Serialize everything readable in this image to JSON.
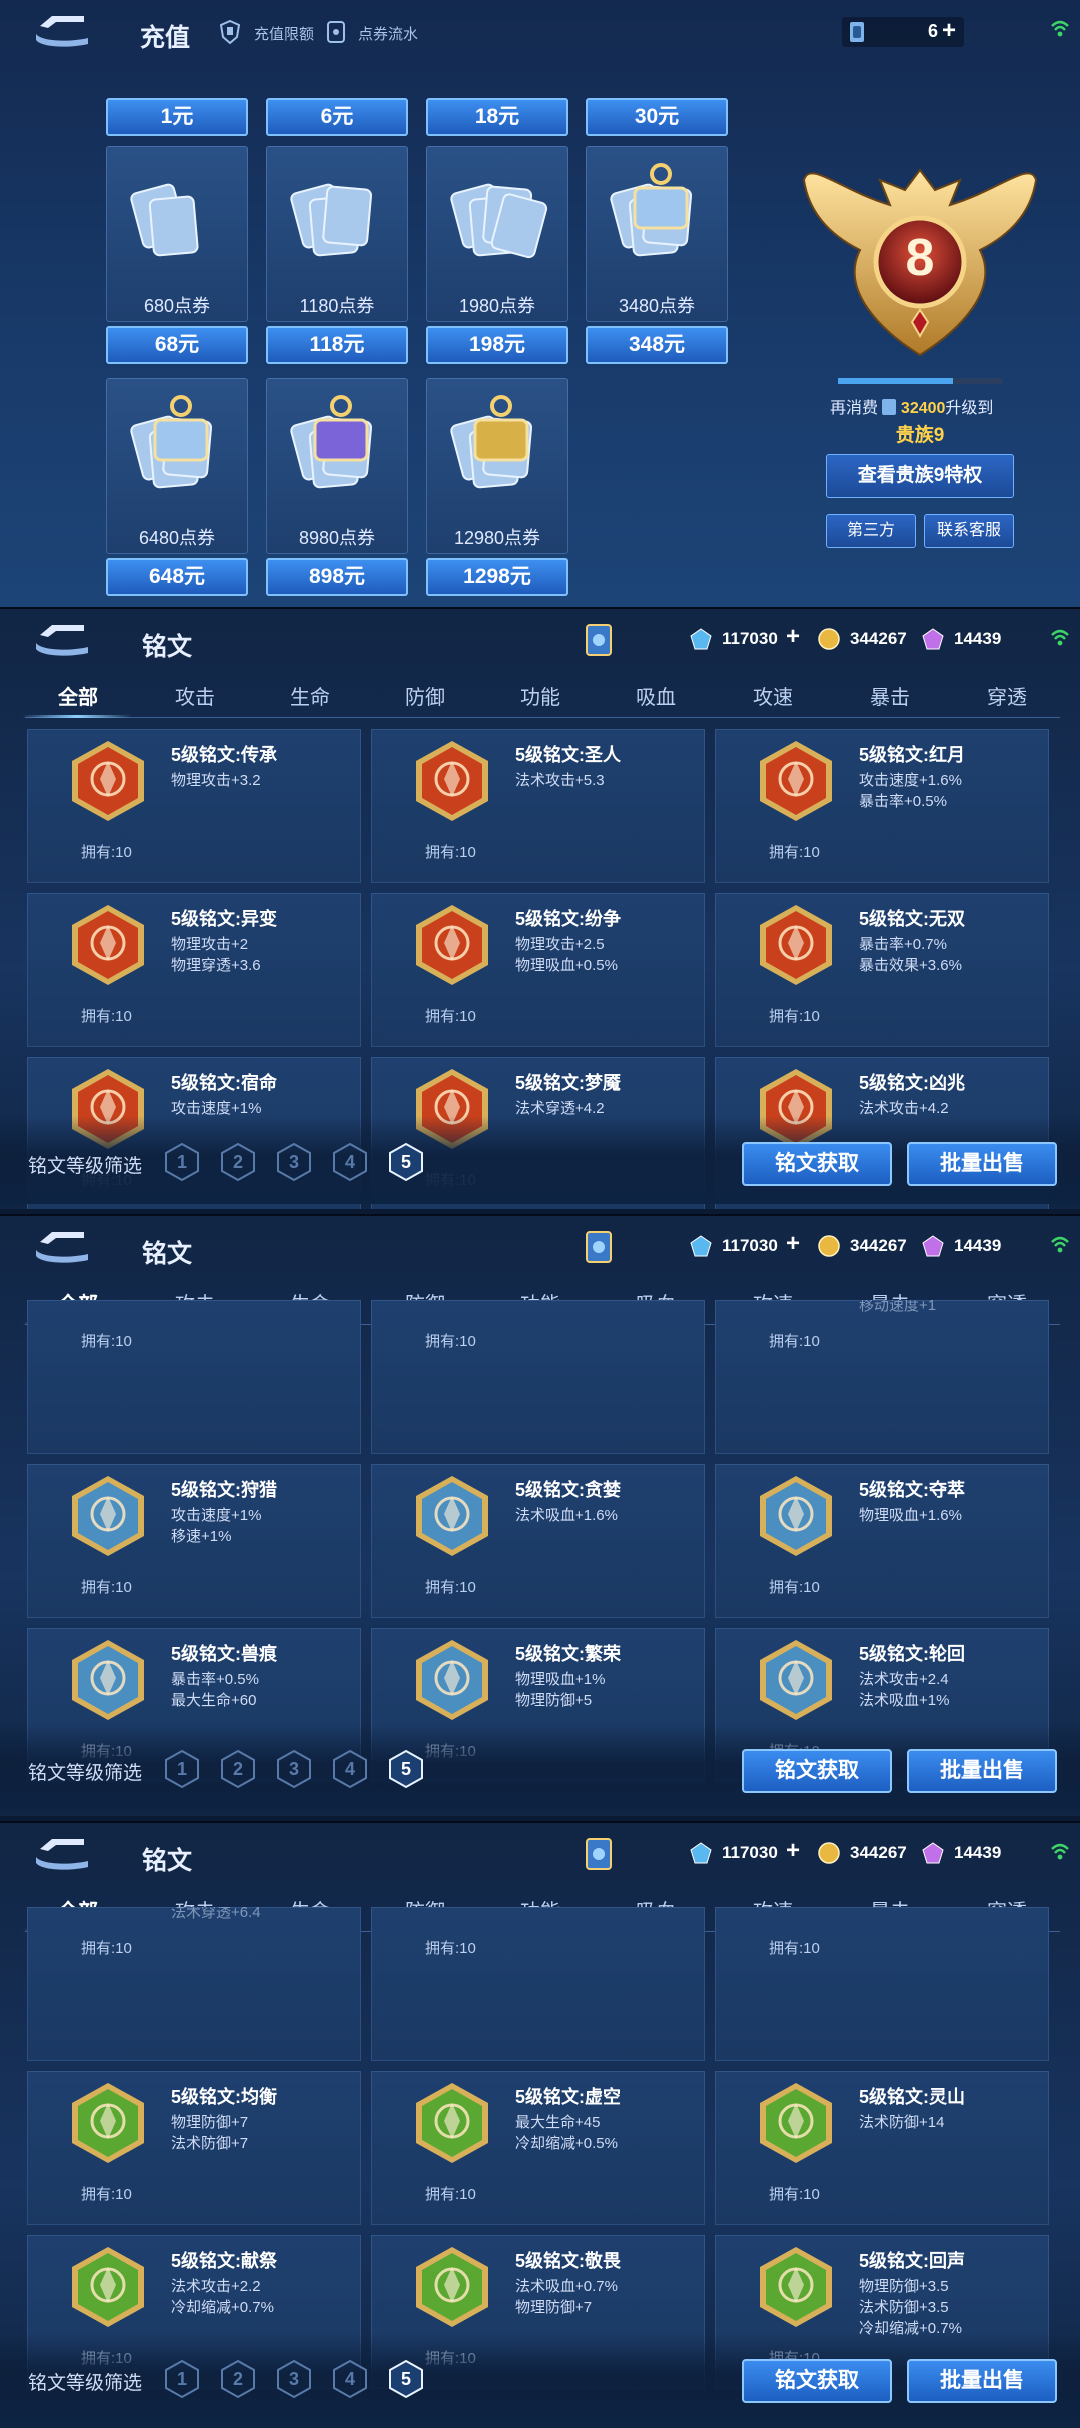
{
  "recharge": {
    "back_icon": "back-arrow-icon",
    "title": "充值",
    "limit_link": "充值限额",
    "flow_link": "点券流水",
    "voucher_count": "6",
    "top_prices": [
      "1元",
      "6元",
      "18元",
      "30元"
    ],
    "packs": [
      {
        "amount": "680点券",
        "price": "68元"
      },
      {
        "amount": "1180点券",
        "price": "118元"
      },
      {
        "amount": "1980点券",
        "price": "198元"
      },
      {
        "amount": "3480点券",
        "price": "348元"
      },
      {
        "amount": "6480点券",
        "price": "648元"
      },
      {
        "amount": "8980点券",
        "price": "898元"
      },
      {
        "amount": "12980点券",
        "price": "1298元"
      }
    ],
    "vip_level": "8",
    "vip_progress": 0.7,
    "upgrade_prefix": "再消费",
    "upgrade_amount": "32400",
    "upgrade_suffix": "升级到",
    "next_level": "贵族9",
    "view_privilege": "查看贵族9特权",
    "third_party": "第三方",
    "contact": "联系客服"
  },
  "rune": {
    "title": "铭文",
    "resources": {
      "diamond": "117030",
      "gold": "344267",
      "crystal": "14439"
    },
    "tabs": [
      "全部",
      "攻击",
      "生命",
      "防御",
      "功能",
      "吸血",
      "攻速",
      "暴击",
      "穿透"
    ],
    "owned_prefix": "拥有:",
    "filter_label": "铭文等级筛选",
    "levels": [
      "1",
      "2",
      "3",
      "4",
      "5"
    ],
    "get_button": "铭文获取",
    "sell_button": "批量出售",
    "colors": {
      "red": "#c8411c",
      "blue": "#4a8fc0",
      "green": "#5aa832",
      "gold": "#d8b05a"
    }
  },
  "screens": [
    {
      "color": "red",
      "rows": [
        [
          {
            "name": "5级铭文:传承",
            "stats": [
              "物理攻击+3.2"
            ],
            "owned": "10"
          },
          {
            "name": "5级铭文:圣人",
            "stats": [
              "法术攻击+5.3"
            ],
            "owned": "10"
          },
          {
            "name": "5级铭文:红月",
            "stats": [
              "攻击速度+1.6%",
              "暴击率+0.5%"
            ],
            "owned": "10"
          }
        ],
        [
          {
            "name": "5级铭文:异变",
            "stats": [
              "物理攻击+2",
              "物理穿透+3.6"
            ],
            "owned": "10"
          },
          {
            "name": "5级铭文:纷争",
            "stats": [
              "物理攻击+2.5",
              "物理吸血+0.5%"
            ],
            "owned": "10"
          },
          {
            "name": "5级铭文:无双",
            "stats": [
              "暴击率+0.7%",
              "暴击效果+3.6%"
            ],
            "owned": "10"
          }
        ],
        [
          {
            "name": "5级铭文:宿命",
            "stats": [
              "攻击速度+1%"
            ],
            "owned": "10"
          },
          {
            "name": "5级铭文:梦魇",
            "stats": [
              "法术穿透+4.2"
            ],
            "owned": "10"
          },
          {
            "name": "5级铭文:凶兆",
            "stats": [
              "法术攻击+4.2"
            ],
            "owned": "10"
          }
        ]
      ]
    },
    {
      "color": "blue",
      "rows": [
        [
          {
            "name": "",
            "stats": [],
            "owned": "10"
          },
          {
            "name": "",
            "stats": [],
            "owned": "10"
          },
          {
            "name": "",
            "stats": [
              "移动速度+1"
            ],
            "owned": "10"
          }
        ],
        [
          {
            "name": "5级铭文:狩猎",
            "stats": [
              "攻击速度+1%",
              "移速+1%"
            ],
            "owned": "10"
          },
          {
            "name": "5级铭文:贪婪",
            "stats": [
              "法术吸血+1.6%"
            ],
            "owned": "10"
          },
          {
            "name": "5级铭文:夺萃",
            "stats": [
              "物理吸血+1.6%"
            ],
            "owned": "10"
          }
        ],
        [
          {
            "name": "5级铭文:兽痕",
            "stats": [
              "暴击率+0.5%",
              "最大生命+60"
            ],
            "owned": "10"
          },
          {
            "name": "5级铭文:繁荣",
            "stats": [
              "物理吸血+1%",
              "物理防御+5"
            ],
            "owned": "10"
          },
          {
            "name": "5级铭文:轮回",
            "stats": [
              "法术攻击+2.4",
              "法术吸血+1%"
            ],
            "owned": "10"
          }
        ]
      ]
    },
    {
      "color": "green",
      "rows": [
        [
          {
            "name": "",
            "stats": [
              "法术穿透+6.4"
            ],
            "owned": "10"
          },
          {
            "name": "",
            "stats": [],
            "owned": "10"
          },
          {
            "name": "",
            "stats": [],
            "owned": "10"
          }
        ],
        [
          {
            "name": "5级铭文:均衡",
            "stats": [
              "物理防御+7",
              "法术防御+7"
            ],
            "owned": "10"
          },
          {
            "name": "5级铭文:虚空",
            "stats": [
              "最大生命+45",
              "冷却缩减+0.5%"
            ],
            "owned": "10"
          },
          {
            "name": "5级铭文:灵山",
            "stats": [
              "法术防御+14"
            ],
            "owned": "10"
          }
        ],
        [
          {
            "name": "5级铭文:献祭",
            "stats": [
              "法术攻击+2.2",
              "冷却缩减+0.7%"
            ],
            "owned": "10"
          },
          {
            "name": "5级铭文:敬畏",
            "stats": [
              "法术吸血+0.7%",
              "物理防御+7"
            ],
            "owned": "10"
          },
          {
            "name": "5级铭文:回声",
            "stats": [
              "物理防御+3.5",
              "法术防御+3.5",
              "冷却缩减+0.7%"
            ],
            "owned": "10"
          }
        ]
      ]
    }
  ]
}
